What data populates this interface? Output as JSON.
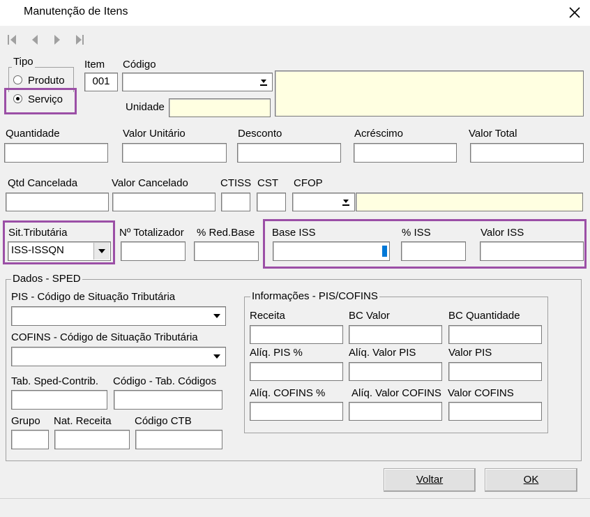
{
  "window": {
    "title": "Manutenção de Itens"
  },
  "tipo": {
    "legend": "Tipo",
    "produto": "Produto",
    "servico": "Serviço",
    "selected": "Serviço"
  },
  "item": {
    "label": "Item",
    "value": "001"
  },
  "codigo": {
    "label": "Código",
    "unidade_label": "Unidade"
  },
  "row2": {
    "quantidade": "Quantidade",
    "valor_unitario": "Valor Unitário",
    "desconto": "Desconto",
    "acrescimo": "Acréscimo",
    "valor_total": "Valor Total"
  },
  "row3": {
    "qtd_cancelada": "Qtd Cancelada",
    "valor_cancelado": "Valor Cancelado",
    "ctiss": "CTISS",
    "cst": "CST",
    "cfop": "CFOP"
  },
  "row4": {
    "sit_trib_label": "Sit.Tributária",
    "sit_trib_value": "ISS-ISSQN",
    "n_totalizador": "Nº Totalizador",
    "pct_red_base": "% Red.Base",
    "base_iss": "Base ISS",
    "pct_iss": "% ISS",
    "valor_iss": "Valor ISS"
  },
  "sped": {
    "legend": "Dados - SPED",
    "pis_label": "PIS -  Código de Situação Tributária",
    "cofins_label": "COFINS -  Código de Situação Tributária",
    "tab_sped": "Tab. Sped-Contrib.",
    "codigo_tab": "Código - Tab. Códigos",
    "grupo": "Grupo",
    "nat_receita": "Nat. Receita",
    "codigo_ctb": "Código CTB"
  },
  "info": {
    "legend": "Informações - PIS/COFINS",
    "receita": "Receita",
    "bc_valor": "BC Valor",
    "bc_quantidade": "BC Quantidade",
    "aliq_pis_pct": "Alíq. PIS %",
    "aliq_valor_pis": "Alíq. Valor PIS",
    "valor_pis": "Valor PIS",
    "aliq_cofins_pct": "Alíq. COFINS %",
    "aliq_valor_cofins": "Alíq. Valor COFINS",
    "valor_cofins": "Valor COFINS"
  },
  "buttons": {
    "voltar": "Voltar",
    "ok": "OK"
  },
  "colors": {
    "highlight": "#9b4fa6",
    "readonly_bg": "#ffffe1"
  },
  "icons": [
    "first-record-icon",
    "previous-record-icon",
    "next-record-icon",
    "last-record-icon",
    "close-icon",
    "dropdown-arrow-icon"
  ]
}
